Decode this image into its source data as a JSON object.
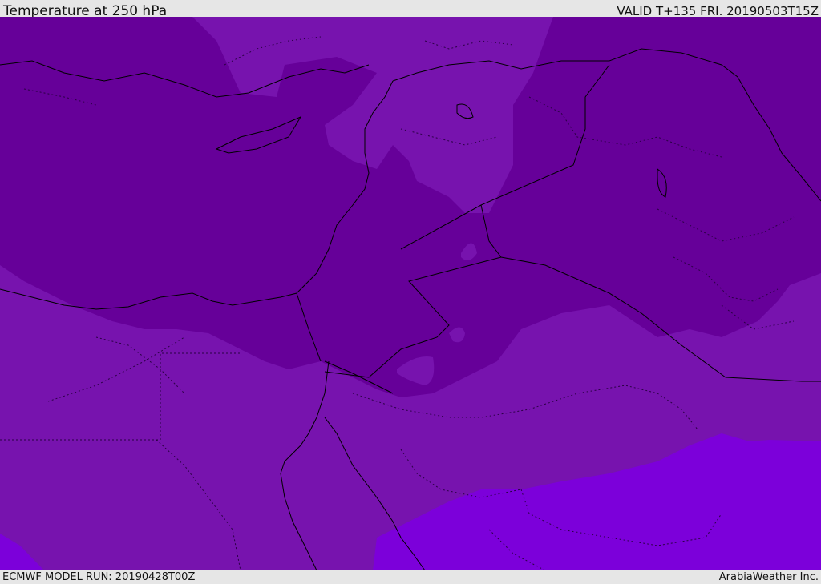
{
  "header": {
    "title": "Temperature at 250 hPa",
    "valid": "VALID T+135 FRI. 20190503T15Z"
  },
  "footer": {
    "model_run": "ECMWF MODEL RUN: 20190428T00Z",
    "credit": "ArabiaWeather Inc."
  },
  "colors": {
    "band_coldest": "#660099",
    "band_cold": "#7713ae",
    "band_mid": "#7a16b3",
    "band_warm": "#7c00da",
    "coastline": "#000000",
    "border_dotted": "#2a0044",
    "background": "#e6e6e6"
  }
}
